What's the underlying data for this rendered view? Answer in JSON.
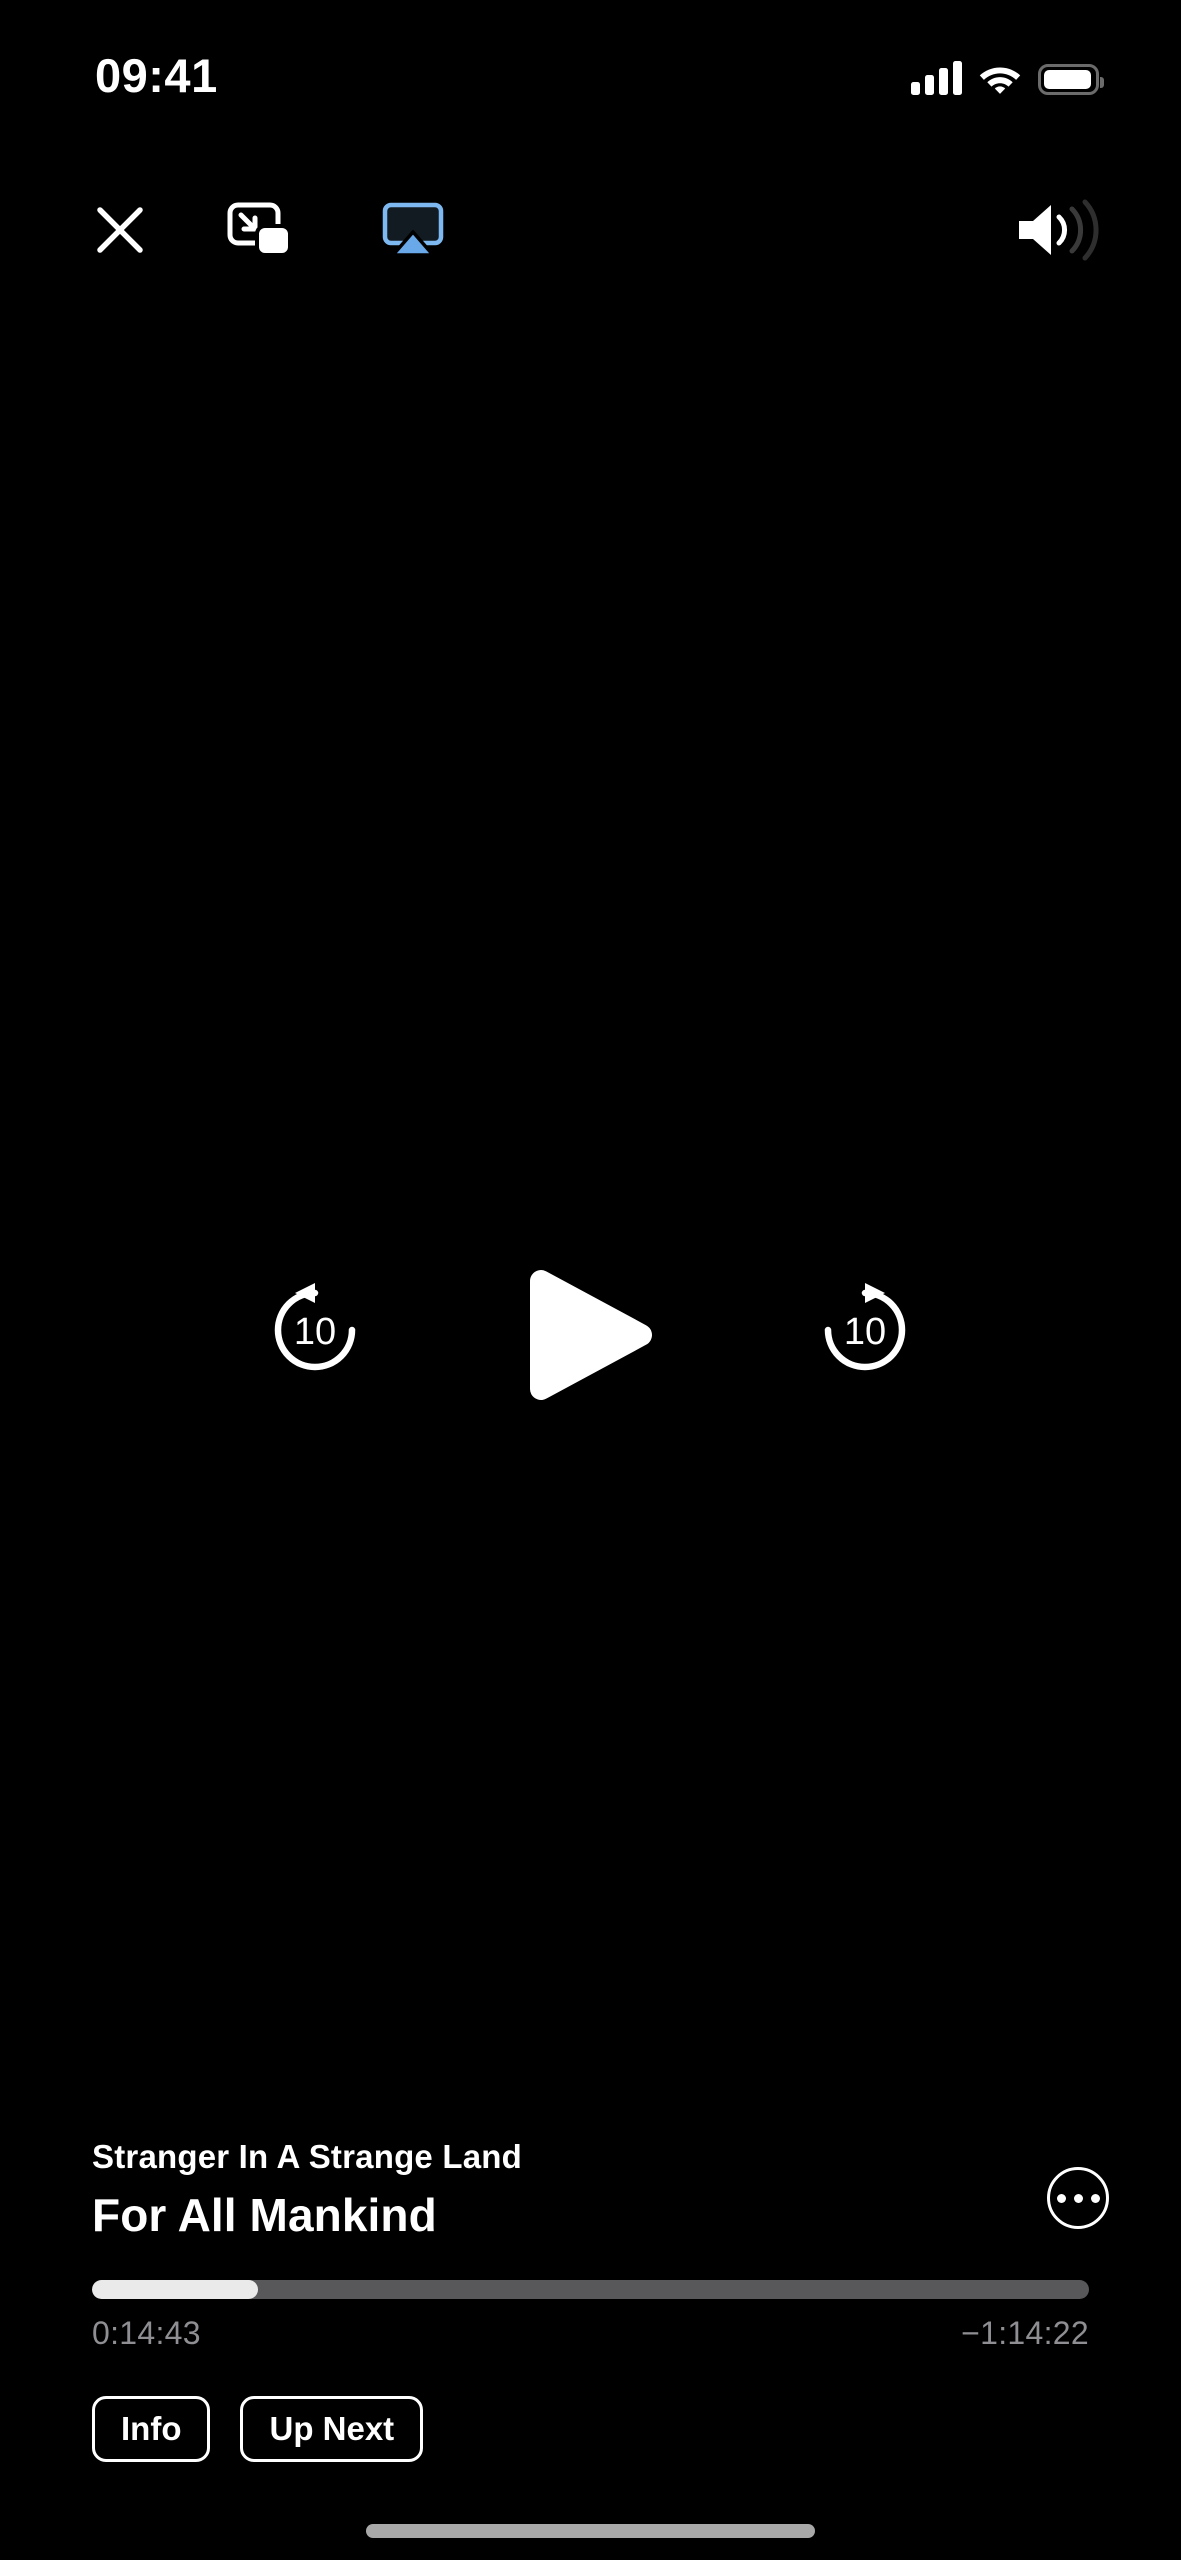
{
  "status_bar": {
    "time": "09:41",
    "cellular_icon": "cellular-bars-icon",
    "cellular_bars_filled": 4,
    "wifi_icon": "wifi-icon",
    "battery_icon": "battery-icon",
    "battery_level_percent": 95
  },
  "top_controls": {
    "close_label": "close-icon",
    "pip_label": "picture-in-picture-icon",
    "airplay_label": "airplay-icon",
    "airplay_active": true,
    "volume_label": "volume-icon"
  },
  "playback": {
    "skip_back_seconds": "10",
    "skip_forward_seconds": "10",
    "play_label": "play-icon",
    "state": "paused"
  },
  "now_playing": {
    "episode_title": "Stranger In A Strange Land",
    "show_title": "For All Mankind",
    "more_options_label": "more-options-icon"
  },
  "progress": {
    "elapsed": "0:14:43",
    "remaining": "−1:14:22",
    "percent": 16.6
  },
  "actions": {
    "info_label": "Info",
    "up_next_label": "Up Next"
  },
  "colors": {
    "background": "#000000",
    "foreground": "#ffffff",
    "muted_text": "#8e8e93",
    "track": "#58585a",
    "fill": "#eaeaea",
    "airplay_accent": "#7eb8f0",
    "airplay_triangle": "#6aa9e9",
    "home_indicator": "#a8a8a8"
  },
  "home_indicator_label": "home-indicator"
}
